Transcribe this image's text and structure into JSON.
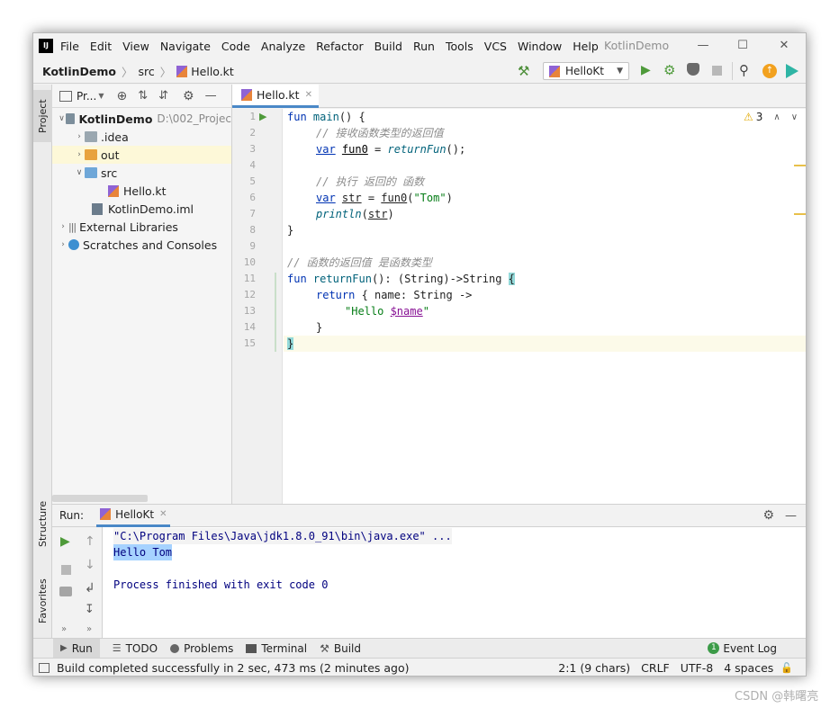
{
  "title_bar": {
    "menus": [
      "File",
      "Edit",
      "View",
      "Navigate",
      "Code",
      "Analyze",
      "Refactor",
      "Build",
      "Run",
      "Tools",
      "VCS",
      "Window",
      "Help"
    ],
    "app_title": "KotlinDemo",
    "logo_text": "IJ"
  },
  "nav_bar": {
    "breadcrumbs": [
      "KotlinDemo",
      "src",
      "Hello.kt"
    ],
    "run_config": "HelloKt"
  },
  "left_strip": {
    "project_tab": "Project",
    "structure_tab": "Structure",
    "favorites_tab": "Favorites"
  },
  "project_panel": {
    "header_label": "Pr...",
    "tree": [
      {
        "label": "KotlinDemo",
        "extra": "D:\\002_Projec"
      },
      {
        "label": ".idea"
      },
      {
        "label": "out"
      },
      {
        "label": "src"
      },
      {
        "label": "Hello.kt"
      },
      {
        "label": "KotlinDemo.iml"
      },
      {
        "label": "External Libraries"
      },
      {
        "label": "Scratches and Consoles"
      }
    ]
  },
  "editor": {
    "tab": "Hello.kt",
    "warnings_count": "3",
    "line_numbers": [
      "1",
      "2",
      "3",
      "4",
      "5",
      "6",
      "7",
      "8",
      "9",
      "10",
      "11",
      "12",
      "13",
      "14",
      "15"
    ],
    "code": {
      "l1_kw": "fun",
      "l1_name": "main",
      "l1_rest": "() {",
      "l2": "// 接收函数类型的返回值",
      "l3_kw": "var",
      "l3_var": "fun0",
      "l3_eq": " = ",
      "l3_call": "returnFun",
      "l3_rest": "();",
      "l5": "// 执行 返回的 函数",
      "l6_kw": "var",
      "l6_var": "str",
      "l6_eq": " = ",
      "l6_call": "fun0",
      "l6_open": "(",
      "l6_str": "\"Tom\"",
      "l6_close": ")",
      "l7_call": "println",
      "l7_open": "(",
      "l7_arg": "str",
      "l7_close": ")",
      "l8": "}",
      "l10": "// 函数的返回值 是函数类型",
      "l11_kw": "fun",
      "l11_name": "returnFun",
      "l11_rest": "(): (String)->String ",
      "l11_brace": "{",
      "l12_kw": "return",
      "l12_rest": " { name: String ->",
      "l13_str": "\"Hello ",
      "l13_tmpl": "$name",
      "l13_end": "\"",
      "l14": "}",
      "l15": "}"
    }
  },
  "run_panel": {
    "label": "Run:",
    "tab": "HelloKt",
    "lines": [
      "\"C:\\Program Files\\Java\\jdk1.8.0_91\\bin\\java.exe\" ...",
      "Hello Tom",
      "",
      "Process finished with exit code 0"
    ]
  },
  "tool_windows": {
    "items": [
      "Run",
      "TODO",
      "Problems",
      "Terminal",
      "Build"
    ],
    "event_log": "Event Log",
    "event_count": "1"
  },
  "status_bar": {
    "message": "Build completed successfully in 2 sec, 473 ms (2 minutes ago)",
    "position": "2:1 (9 chars)",
    "line_sep": "CRLF",
    "encoding": "UTF-8",
    "indent": "4 spaces"
  },
  "watermark": "CSDN @韩曙亮",
  "colors": {
    "keyword": "#0033b3",
    "comment": "#8c8c8c",
    "string": "#067d17",
    "function": "#00627a",
    "console_blue": "#00007f",
    "selection": "#a6d2ff"
  }
}
